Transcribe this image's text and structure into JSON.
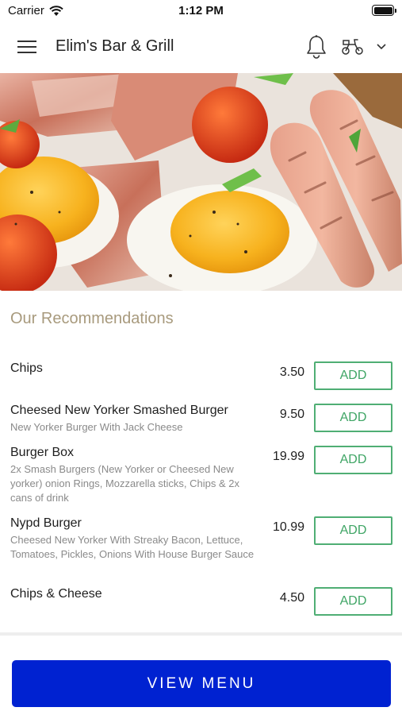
{
  "status_bar": {
    "carrier": "Carrier",
    "time": "1:12 PM",
    "wifi_icon": "wifi-icon",
    "battery_icon": "battery-icon"
  },
  "header": {
    "title": "Elim's Bar & Grill",
    "menu_icon": "hamburger-menu-icon",
    "notification_icon": "bell-icon",
    "delivery_icon": "scooter-icon",
    "dropdown_icon": "chevron-down-icon"
  },
  "hero": {
    "image_subject": "breakfast-food-photo"
  },
  "recommendations": {
    "title": "Our Recommendations",
    "add_label": "ADD",
    "items": [
      {
        "name": "Chips",
        "description": "",
        "price": "3.50"
      },
      {
        "name": "Cheesed New Yorker Smashed Burger",
        "description": "New Yorker Burger With Jack Cheese",
        "price": "9.50"
      },
      {
        "name": "Burger Box",
        "description": "2x Smash Burgers (New Yorker or Cheesed New yorker) onion Rings, Mozzarella sticks, Chips & 2x cans of drink",
        "price": "19.99"
      },
      {
        "name": "Nypd Burger",
        "description": "Cheesed New Yorker With Streaky Bacon, Lettuce, Tomatoes, Pickles, Onions With House Burger Sauce",
        "price": "10.99"
      },
      {
        "name": "Chips & Cheese",
        "description": "",
        "price": "4.50"
      }
    ]
  },
  "footer": {
    "view_menu_label": "VIEW MENU"
  },
  "colors": {
    "accent_green": "#4fae74",
    "section_title": "#a89a7d",
    "primary_button": "#0022d1"
  }
}
